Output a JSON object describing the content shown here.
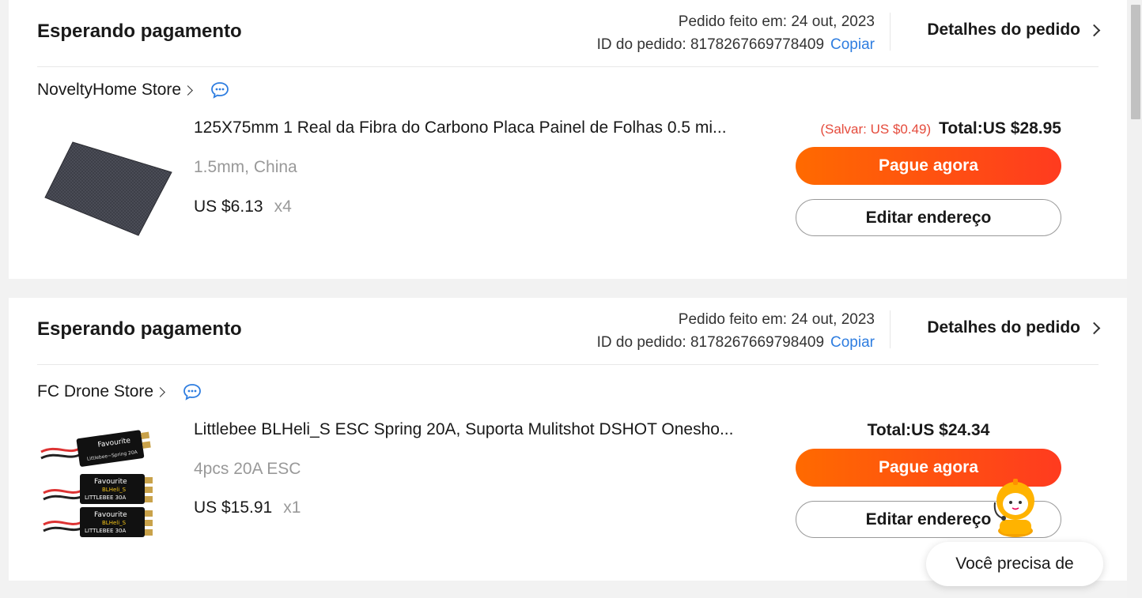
{
  "orders": [
    {
      "status": "Esperando pagamento",
      "date_line": "Pedido feito em: 24 out, 2023",
      "id_label": "ID do pedido: 8178267669778409",
      "copy_label": "Copiar",
      "details_label": "Detalhes do pedido",
      "store": "NoveltyHome Store",
      "product_title": "125X75mm 1 Real da Fibra do Carbono Placa Painel de Folhas 0.5 mi...",
      "variant": "1.5mm, China",
      "price": "US $6.13",
      "qty": "x4",
      "save_note": "(Salvar: US $0.49)",
      "total": "Total:US $28.95",
      "pay_label": "Pague agora",
      "edit_label": "Editar endereço"
    },
    {
      "status": "Esperando pagamento",
      "date_line": "Pedido feito em: 24 out, 2023",
      "id_label": "ID do pedido: 8178267669798409",
      "copy_label": "Copiar",
      "details_label": "Detalhes do pedido",
      "store": "FC Drone Store",
      "product_title": "Littlebee BLHeli_S ESC Spring 20A, Suporta Mulitshot DSHOT Onesho...",
      "variant": "4pcs 20A ESC",
      "price": "US $15.91",
      "qty": "x1",
      "total": "Total:US $24.34",
      "pay_label": "Pague agora",
      "edit_label": "Editar endereço",
      "esc_labels": {
        "brand": "Favourite",
        "series": "BLHeli_S",
        "model": "LITTLEBEE 30A",
        "spring": "Littlebee~Spring 20A"
      }
    }
  ],
  "assistant": {
    "bubble_text": "Você precisa de"
  },
  "colors": {
    "accent_orange": "#ff6a00",
    "accent_red": "#ff3b1f",
    "link_blue": "#2e7de0",
    "save_red": "#e54b3c"
  }
}
